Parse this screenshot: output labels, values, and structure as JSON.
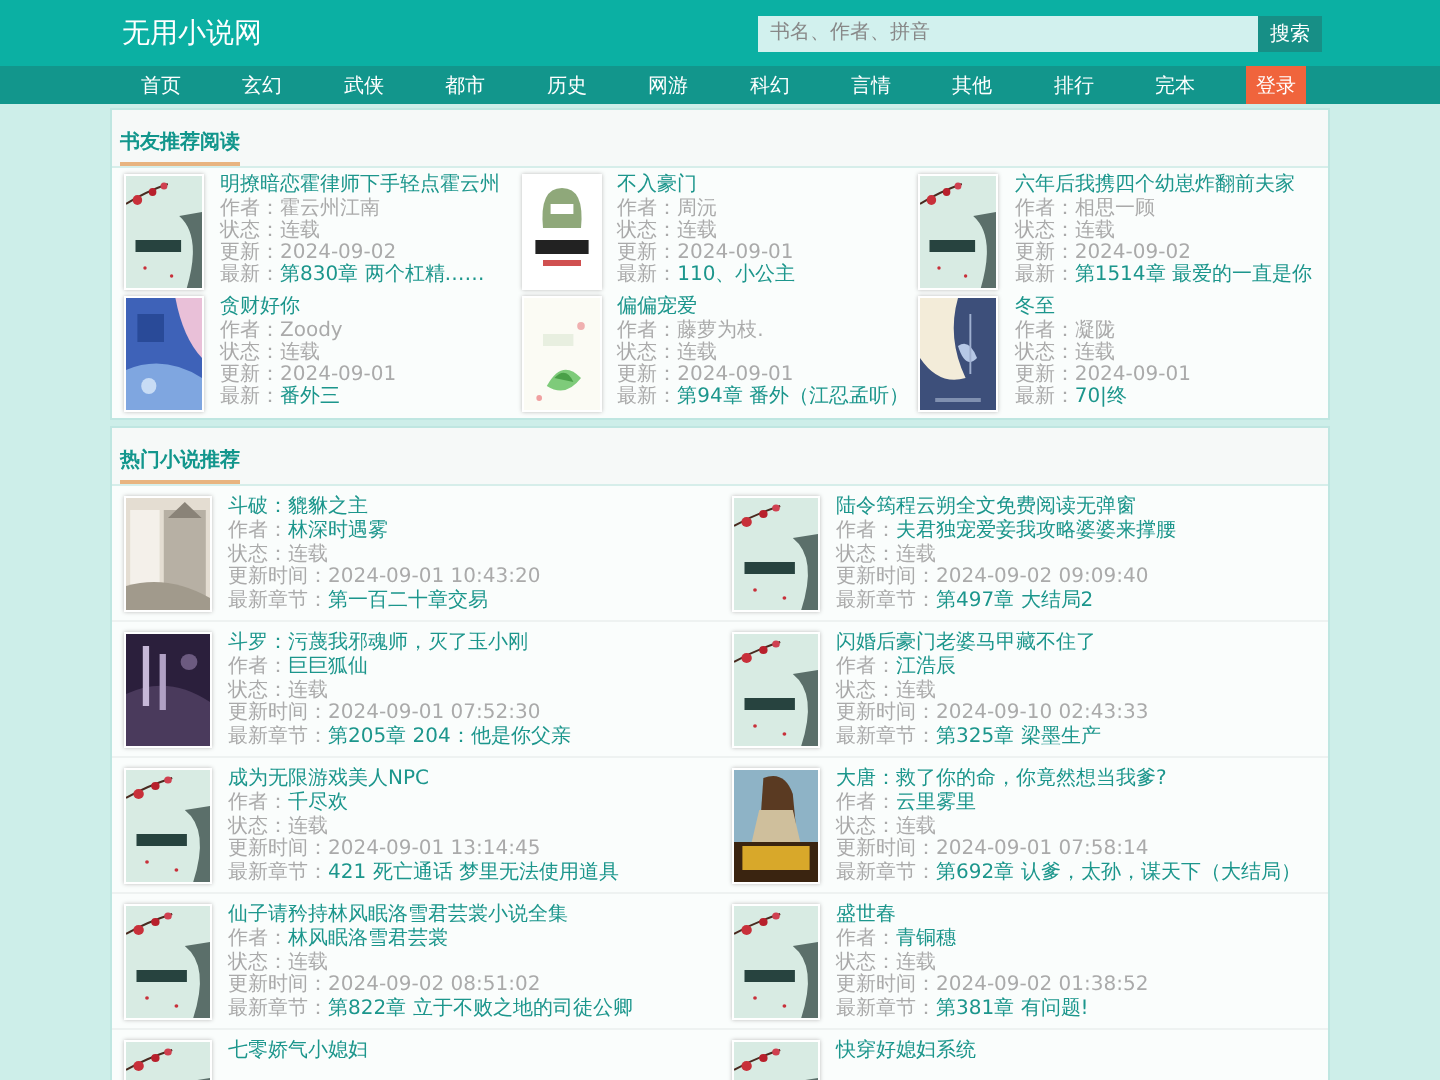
{
  "site": {
    "logo": "无用小说网",
    "search": {
      "placeholder": "书名、作者、拼音",
      "button": "搜索"
    }
  },
  "nav": [
    {
      "label": "首页",
      "kind": "link"
    },
    {
      "label": "玄幻",
      "kind": "link"
    },
    {
      "label": "武侠",
      "kind": "link"
    },
    {
      "label": "都市",
      "kind": "link"
    },
    {
      "label": "历史",
      "kind": "link"
    },
    {
      "label": "网游",
      "kind": "link"
    },
    {
      "label": "科幻",
      "kind": "link"
    },
    {
      "label": "言情",
      "kind": "link"
    },
    {
      "label": "其他",
      "kind": "link"
    },
    {
      "label": "排行",
      "kind": "link"
    },
    {
      "label": "完本",
      "kind": "link"
    },
    {
      "label": "登录",
      "kind": "button"
    }
  ],
  "recommend": {
    "title": "书友推荐阅读",
    "books": [
      {
        "title": "明撩暗恋霍律师下手轻点霍云州",
        "lines": [
          {
            "label": "作者：",
            "value": "霍云州江南",
            "kind": "plain"
          },
          {
            "label": "状态：",
            "value": "连载",
            "kind": "plain"
          },
          {
            "label": "更新：",
            "value": "2024-09-02",
            "kind": "plain"
          },
          {
            "label": "最新：",
            "value": "第830章 两个杠精……",
            "kind": "link"
          }
        ]
      },
      {
        "title": "不入豪门",
        "lines": [
          {
            "label": "作者：",
            "value": "周沅",
            "kind": "plain"
          },
          {
            "label": "状态：",
            "value": "连载",
            "kind": "plain"
          },
          {
            "label": "更新：",
            "value": "2024-09-01",
            "kind": "plain"
          },
          {
            "label": "最新：",
            "value": "110、小公主",
            "kind": "link"
          }
        ]
      },
      {
        "title": "六年后我携四个幼崽炸翻前夫家",
        "lines": [
          {
            "label": "作者：",
            "value": "相思一顾",
            "kind": "plain"
          },
          {
            "label": "状态：",
            "value": "连载",
            "kind": "plain"
          },
          {
            "label": "更新：",
            "value": "2024-09-02",
            "kind": "plain"
          },
          {
            "label": "最新：",
            "value": "第1514章 最爱的一直是你",
            "kind": "link"
          }
        ]
      },
      {
        "title": "贪财好你",
        "lines": [
          {
            "label": "作者：",
            "value": "Zoody",
            "kind": "plain"
          },
          {
            "label": "状态：",
            "value": "连载",
            "kind": "plain"
          },
          {
            "label": "更新：",
            "value": "2024-09-01",
            "kind": "plain"
          },
          {
            "label": "最新：",
            "value": "番外三",
            "kind": "link"
          }
        ]
      },
      {
        "title": "偏偏宠爱",
        "lines": [
          {
            "label": "作者：",
            "value": "藤萝为枝.",
            "kind": "plain"
          },
          {
            "label": "状态：",
            "value": "连载",
            "kind": "plain"
          },
          {
            "label": "更新：",
            "value": "2024-09-01",
            "kind": "plain"
          },
          {
            "label": "最新：",
            "value": "第94章 番外（江忍孟听）",
            "kind": "link"
          }
        ]
      },
      {
        "title": "冬至",
        "lines": [
          {
            "label": "作者：",
            "value": "凝陇",
            "kind": "plain"
          },
          {
            "label": "状态：",
            "value": "连载",
            "kind": "plain"
          },
          {
            "label": "更新：",
            "value": "2024-09-01",
            "kind": "plain"
          },
          {
            "label": "最新：",
            "value": "70|终",
            "kind": "link"
          }
        ]
      }
    ]
  },
  "hot": {
    "title": "热门小说推荐",
    "books": [
      {
        "title": "斗破：貔貅之主",
        "lines": [
          {
            "label": "作者：",
            "value": "林深时遇雾",
            "kind": "link"
          },
          {
            "label": "状态：",
            "value": "连载",
            "kind": "plain"
          },
          {
            "label": "更新时间：",
            "value": "2024-09-01 10:43:20",
            "kind": "plain"
          },
          {
            "label": "最新章节：",
            "value": "第一百二十章交易",
            "kind": "link"
          }
        ]
      },
      {
        "title": "陆令筠程云朔全文免费阅读无弹窗",
        "lines": [
          {
            "label": "作者：",
            "value": "夫君独宠爱妾我攻略婆婆来撑腰",
            "kind": "link"
          },
          {
            "label": "状态：",
            "value": "连载",
            "kind": "plain"
          },
          {
            "label": "更新时间：",
            "value": "2024-09-02 09:09:40",
            "kind": "plain"
          },
          {
            "label": "最新章节：",
            "value": "第497章 大结局2",
            "kind": "link"
          }
        ]
      },
      {
        "title": "斗罗：污蔑我邪魂师，灭了玉小刚",
        "lines": [
          {
            "label": "作者：",
            "value": "巨巨狐仙",
            "kind": "link"
          },
          {
            "label": "状态：",
            "value": "连载",
            "kind": "plain"
          },
          {
            "label": "更新时间：",
            "value": "2024-09-01 07:52:30",
            "kind": "plain"
          },
          {
            "label": "最新章节：",
            "value": "第205章 204：他是你父亲",
            "kind": "link"
          }
        ]
      },
      {
        "title": "闪婚后豪门老婆马甲藏不住了",
        "lines": [
          {
            "label": "作者：",
            "value": "江浩辰",
            "kind": "link"
          },
          {
            "label": "状态：",
            "value": "连载",
            "kind": "plain"
          },
          {
            "label": "更新时间：",
            "value": "2024-09-10 02:43:33",
            "kind": "plain"
          },
          {
            "label": "最新章节：",
            "value": "第325章 梁墨生产",
            "kind": "link"
          }
        ]
      },
      {
        "title": "成为无限游戏美人NPC",
        "lines": [
          {
            "label": "作者：",
            "value": "千尽欢",
            "kind": "link"
          },
          {
            "label": "状态：",
            "value": "连载",
            "kind": "plain"
          },
          {
            "label": "更新时间：",
            "value": "2024-09-01 13:14:45",
            "kind": "plain"
          },
          {
            "label": "最新章节：",
            "value": "421 死亡通话 梦里无法使用道具",
            "kind": "link"
          }
        ]
      },
      {
        "title": "大唐：救了你的命，你竟然想当我爹?",
        "lines": [
          {
            "label": "作者：",
            "value": "云里雾里",
            "kind": "link"
          },
          {
            "label": "状态：",
            "value": "连载",
            "kind": "plain"
          },
          {
            "label": "更新时间：",
            "value": "2024-09-01 07:58:14",
            "kind": "plain"
          },
          {
            "label": "最新章节：",
            "value": "第692章 认爹，太孙，谋天下（大结局）",
            "kind": "link"
          }
        ]
      },
      {
        "title": "仙子请矜持林风眠洛雪君芸裳小说全集",
        "lines": [
          {
            "label": "作者：",
            "value": "林风眠洛雪君芸裳",
            "kind": "link"
          },
          {
            "label": "状态：",
            "value": "连载",
            "kind": "plain"
          },
          {
            "label": "更新时间：",
            "value": "2024-09-02 08:51:02",
            "kind": "plain"
          },
          {
            "label": "最新章节：",
            "value": "第822章 立于不败之地的司徒公卿",
            "kind": "link"
          }
        ]
      },
      {
        "title": "盛世春",
        "lines": [
          {
            "label": "作者：",
            "value": "青铜穗",
            "kind": "link"
          },
          {
            "label": "状态：",
            "value": "连载",
            "kind": "plain"
          },
          {
            "label": "更新时间：",
            "value": "2024-09-02 01:38:52",
            "kind": "plain"
          },
          {
            "label": "最新章节：",
            "value": "第381章 有问题!",
            "kind": "link"
          }
        ]
      },
      {
        "title": "七零娇气小媳妇"
      },
      {
        "title": "快穿好媳妇系统"
      }
    ]
  }
}
